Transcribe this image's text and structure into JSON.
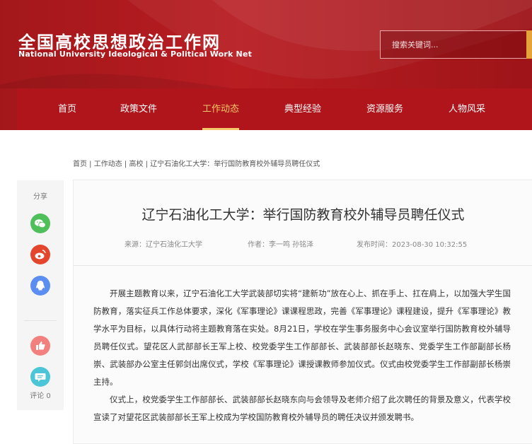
{
  "site": {
    "logo_cn": "全国高校思想政治工作网",
    "logo_en": "National University Ideological & Political Work Net",
    "search_placeholder": "搜索关键词..."
  },
  "nav": {
    "items": [
      {
        "label": "首页",
        "active": false
      },
      {
        "label": "政策文件",
        "active": false
      },
      {
        "label": "工作动态",
        "active": true
      },
      {
        "label": "典型经验",
        "active": false
      },
      {
        "label": "资源服务",
        "active": false
      },
      {
        "label": "人物风采",
        "active": false
      }
    ]
  },
  "breadcrumb": [
    "首页",
    "工作动态",
    "高校",
    "辽宁石油化工大学：举行国防教育校外辅导员聘任仪式"
  ],
  "share": {
    "label": "分享",
    "comment_label": "评论",
    "comment_count": "0"
  },
  "article": {
    "title": "辽宁石油化工大学：举行国防教育校外辅导员聘任仪式",
    "source": "来源：辽宁石油化工大学",
    "author": "作者：李一鸣 孙铭泽",
    "published": "发布时间：2023-08-30 10:32:55",
    "paragraphs": [
      "开展主题教育以来，辽宁石油化工大学武装部切实将“建新功”放在心上、抓在手上、扛在肩上，以加强大学生国防教育，落实征兵工作总体要求，深化《军事理论》课课程思政，完善《军事理论》课程建设，提升《军事理论》教学水平为目标，以具体行动将主题教育落在实处。8月21日，学校在学生事务服务中心会议室举行国防教育校外辅导员聘任仪式。望花区人武部部长王军上校、校党委学生工作部部长、武装部部长赵晓东、党委学生工作部副部长杨崇、武装部办公室主任郭剑出席仪式，学校《军事理论》课授课教师参加仪式。仪式由校党委学生工作部副部长杨崇主持。",
      "仪式上，校党委学生工作部部长、武装部部长赵晓东向与会领导及老师介绍了此次聘任的背景及意义，代表学校宣读了对望花区武装部部长王军上校成为学校国防教育校外辅导员的聘任决议并颁发聘书。"
    ]
  },
  "colors": {
    "brand_red": "#b0151b",
    "active_gold": "#f5c86b",
    "wechat_green": "#4fbf5a",
    "weibo_red": "#e3452d",
    "qq_blue": "#5b8ef0",
    "like_pink": "#f2807e",
    "comment_teal": "#4cc5d6"
  },
  "icons": [
    "wechat-icon",
    "weibo-icon",
    "qq-icon",
    "like-icon",
    "comment-icon"
  ]
}
